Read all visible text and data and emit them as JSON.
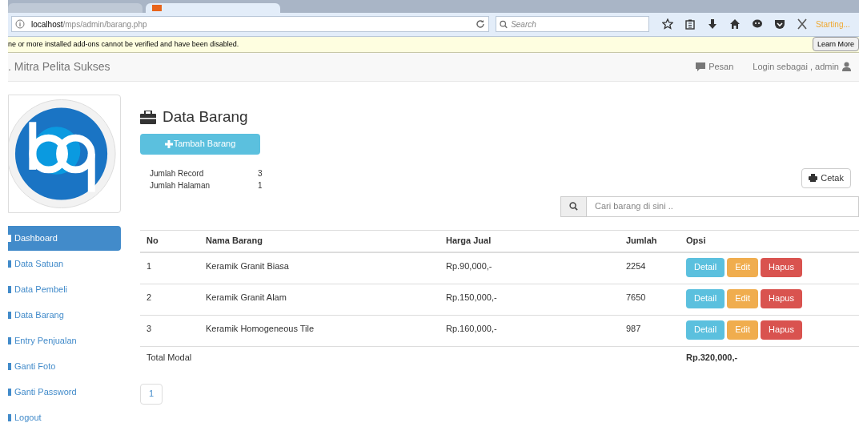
{
  "browser": {
    "tabs": [
      {
        "selected": false
      },
      {
        "selected": true
      }
    ],
    "url_host": "localhost",
    "url_path": "/mps/admin/barang.php",
    "search_placeholder": "Search",
    "status": "Starting...",
    "notification": "ne or more installed add-ons cannot be verified and have been disabled.",
    "notification_button": "Learn More"
  },
  "navbar": {
    "brand": ". Mitra Pelita Sukses",
    "links": [
      "Pesan",
      "Login sebagai , admin"
    ]
  },
  "sidebar": {
    "items": [
      {
        "label": "Dashboard",
        "selected": true
      },
      {
        "label": "Data Satuan",
        "selected": false
      },
      {
        "label": "Data Pembeli",
        "selected": false
      },
      {
        "label": "Data Barang",
        "selected": false
      },
      {
        "label": "Entry Penjualan",
        "selected": false
      },
      {
        "label": "Ganti Foto",
        "selected": false
      },
      {
        "label": "Ganti Password",
        "selected": false
      },
      {
        "label": "Logout",
        "selected": false
      }
    ]
  },
  "page": {
    "title": "Data Barang",
    "add_button": "Tambah Barang",
    "stats": [
      {
        "label": "Jumlah Record",
        "value": "3"
      },
      {
        "label": "Jumlah Halaman",
        "value": "1"
      }
    ],
    "print_button": "Cetak",
    "search_placeholder": "Cari barang di sini .."
  },
  "table": {
    "columns": [
      "No",
      "Nama Barang",
      "Harga Jual",
      "Jumlah",
      "Opsi"
    ],
    "rows": [
      {
        "no": "1",
        "name": "Keramik Granit Biasa",
        "price": "Rp.90,000,-",
        "qty": "2254",
        "actions": [
          "Detail",
          "Edit",
          "Hapus"
        ]
      },
      {
        "no": "2",
        "name": "Keramik Granit Alam",
        "price": "Rp.150,000,-",
        "qty": "7650",
        "actions": [
          "Detail",
          "Edit",
          "Hapus"
        ]
      },
      {
        "no": "3",
        "name": "Keramik Homogeneous Tile",
        "price": "Rp.160,000,-",
        "qty": "987",
        "actions": [
          "Detail",
          "Edit",
          "Hapus"
        ]
      }
    ],
    "total_label": "Total Modal",
    "total_value": "Rp.320,000,-"
  },
  "pagination": [
    {
      "label": "1",
      "selected": false
    }
  ]
}
